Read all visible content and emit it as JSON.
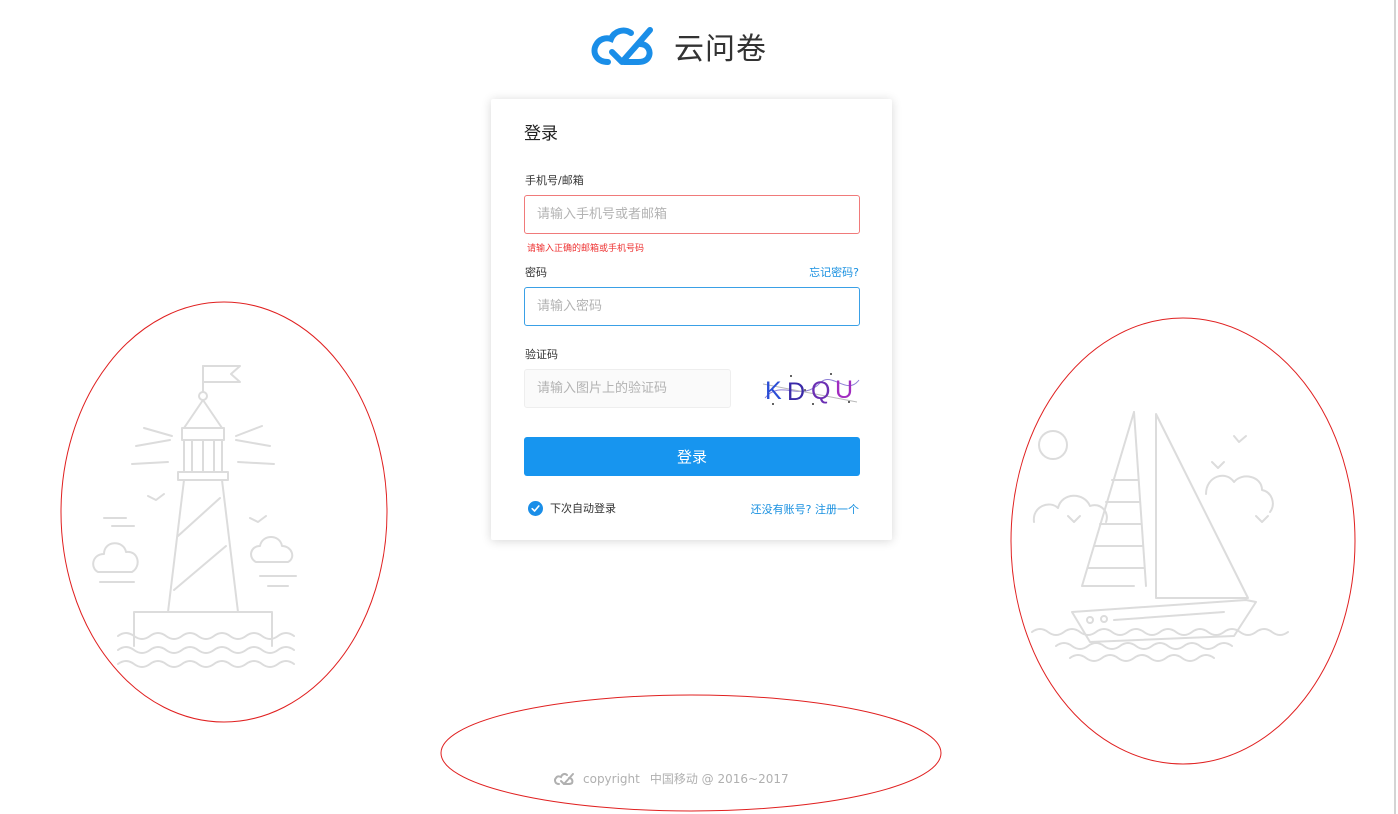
{
  "brand": {
    "name": "云问卷",
    "icon": "cloud-check-logo-icon",
    "color": "#1a8ee8"
  },
  "login": {
    "title": "登录",
    "account": {
      "label": "手机号/邮箱",
      "placeholder": "请输入手机号或者邮箱",
      "value": "",
      "error": "请输入正确的邮箱或手机号码"
    },
    "password": {
      "label": "密码",
      "placeholder": "请输入密码",
      "value": "",
      "forgot": "忘记密码?"
    },
    "captcha": {
      "label": "验证码",
      "placeholder": "请输入图片上的验证码",
      "value": "",
      "image_text": "KDQU"
    },
    "submit": "登录",
    "remember": {
      "label": "下次自动登录",
      "checked": true
    },
    "register": "还没有账号? 注册一个"
  },
  "footer": {
    "copyright": "copyright",
    "company": "中国移动 @ 2016~2017"
  },
  "colors": {
    "accent": "#1795ef",
    "error": "#ee3333",
    "link": "#1890e0"
  }
}
